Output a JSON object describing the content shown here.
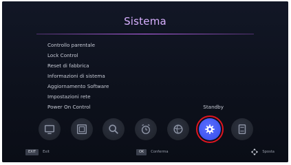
{
  "header": {
    "title": "Sistema"
  },
  "menu": {
    "items": [
      {
        "label": "Controllo parentale",
        "value": ""
      },
      {
        "label": "Lock Control",
        "value": ""
      },
      {
        "label": "Reset di fabbrica",
        "value": ""
      },
      {
        "label": "Informazioni di sistema",
        "value": ""
      },
      {
        "label": "Aggiornamento Software",
        "value": ""
      },
      {
        "label": "Impostazioni rete",
        "value": ""
      },
      {
        "label": "Power On Control",
        "value": "Standby"
      }
    ]
  },
  "icon_bar": {
    "icons": [
      "tv-icon",
      "picture-icon",
      "search-icon",
      "clock-icon",
      "globe-icon",
      "gear-icon",
      "storage-icon"
    ],
    "active_index": 5,
    "active_color": "#3f55f0",
    "highlight_color": "#e01520"
  },
  "footer": {
    "exit_key": "EXIT",
    "exit_label": "Exit",
    "ok_key": "OK",
    "ok_label": "Conferma",
    "move_label": "Sposta"
  },
  "colors": {
    "title": "#d8b0ff",
    "divider": "#c86bff",
    "background": "#0d111c"
  }
}
